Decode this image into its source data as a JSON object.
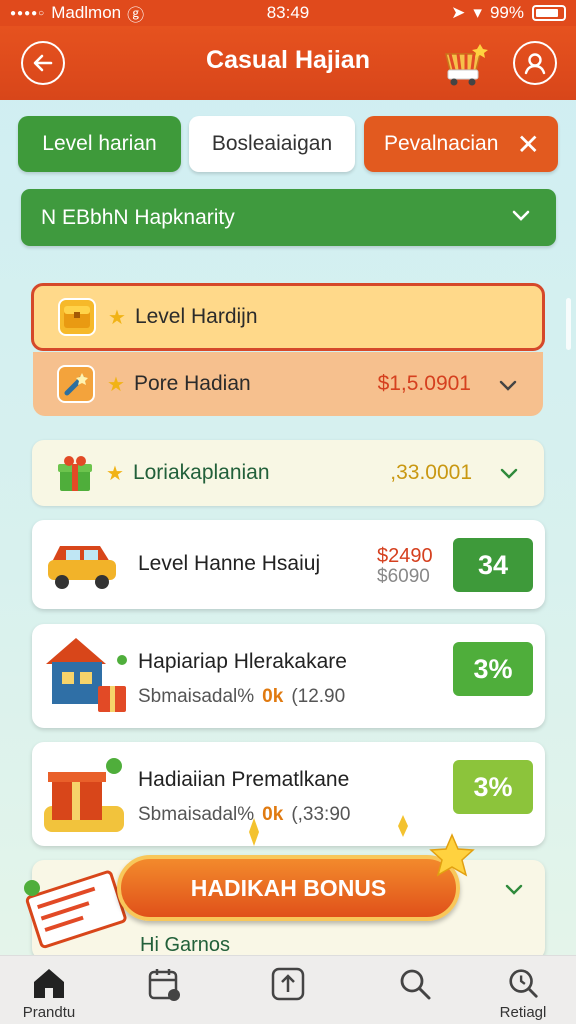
{
  "status": {
    "carrier": "Madlmon",
    "time": "83:49",
    "battery": "99%"
  },
  "header": {
    "title": "Casual Hajian"
  },
  "tabs": [
    {
      "label": "Level harian"
    },
    {
      "label": "Bosleaiaigan"
    },
    {
      "label": "Pevalnacian"
    }
  ],
  "filter": {
    "label": "N EBbhN Hapknarity"
  },
  "rows": [
    {
      "label": "Level Hardijn",
      "amount": ""
    },
    {
      "label": "Pore Hadian",
      "amount": "$1,5.0901"
    },
    {
      "label": "Loriakaplanian",
      "amount": ",33.0001"
    }
  ],
  "cards": [
    {
      "title": "Level Hanne Hsaiuj",
      "price": "$2490",
      "old_price": "$6090",
      "pill": "34"
    },
    {
      "title": "Hapiariap Hlerakakare",
      "sub1": "Sbmaisadal%",
      "ok": "0k",
      "sub2": "(12.90",
      "pill": "3%"
    },
    {
      "title": "Hadiaiian Prematlkane",
      "sub1": "Sbmaisadal%",
      "ok": "0k",
      "sub2": "(,33:90",
      "pill": "3%"
    }
  ],
  "bonus": {
    "label": "HADIKAH BONUS",
    "sub": "Hi Garnos"
  },
  "nav": {
    "home_label": "Prandtu",
    "last_label": "Retiagl"
  },
  "colors": {
    "accent": "#e04a1c",
    "green": "#3e9a3a",
    "pill_green": "#4fae3b",
    "pill_lime": "#8cc43b"
  }
}
